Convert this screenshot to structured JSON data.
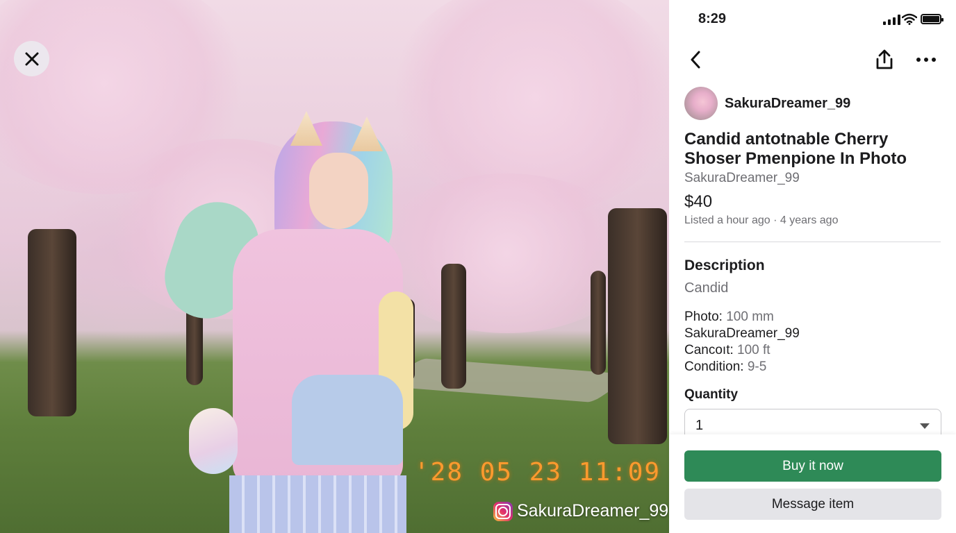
{
  "photo": {
    "date_stamp": "'28 05 23 11:09",
    "watermark_handle": "SakuraDreamer_99"
  },
  "status_bar": {
    "time": "8:29"
  },
  "seller": {
    "name": "SakuraDreamer_99"
  },
  "listing": {
    "title": "Candid antotnable Cherry Shoser Pmenpione In Photo",
    "seller_line": "SakuraDreamer_99",
    "price": "$40",
    "listed": "Listed a hour ago · 4 years ago"
  },
  "description": {
    "heading": "Description",
    "subtitle": "Candid",
    "specs": [
      {
        "key": "Photo:",
        "value": "100 mm"
      },
      {
        "key": "SakuraDreamer_99",
        "value": ""
      },
      {
        "key": "Cancoıt:",
        "value": "100 ft"
      },
      {
        "key": "Condition:",
        "value": "9-5"
      }
    ]
  },
  "quantity": {
    "heading": "Quantity",
    "value": "1"
  },
  "actions": {
    "buy": "Buy it now",
    "message": "Message item"
  },
  "icons": [
    "close-icon",
    "back-icon",
    "share-icon",
    "more-icon",
    "signal-icon",
    "wifi-icon",
    "battery-icon",
    "instagram-icon",
    "chevron-down-icon"
  ],
  "colors": {
    "buy_button": "#2e8a57",
    "stamp": "#ff9a2e"
  }
}
